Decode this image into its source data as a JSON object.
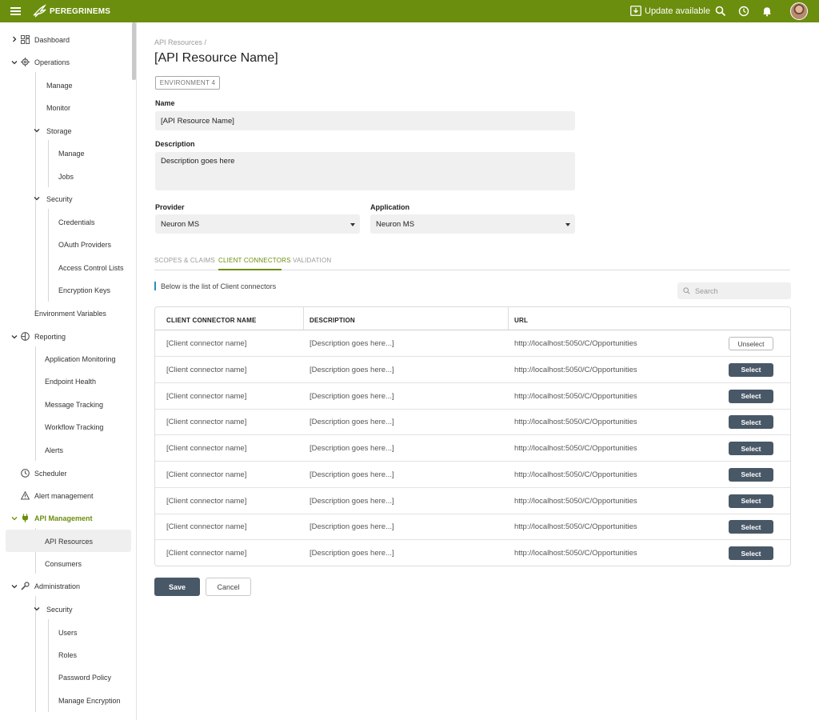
{
  "colors": {
    "brand": "#6b8e0e",
    "button_dark": "#495867",
    "info_accent": "#2d8fb7"
  },
  "topbar": {
    "logo_text": "PEREGRINEMS",
    "update_label": "Update available",
    "icons": [
      "menu-icon",
      "download-icon",
      "search-icon",
      "clock-icon",
      "bell-icon"
    ]
  },
  "sidebar": {
    "dashboard": "Dashboard",
    "operations": "Operations",
    "ops_manage": "Manage",
    "ops_monitor": "Monitor",
    "storage": "Storage",
    "storage_manage": "Manage",
    "storage_jobs": "Jobs",
    "security": "Security",
    "credentials": "Credentials",
    "oauth": "OAuth Providers",
    "acl": "Access Control Lists",
    "enc_keys": "Encryption Keys",
    "env_vars": "Environment Variables",
    "reporting": "Reporting",
    "app_monitoring": "Application Monitoring",
    "endpoint_health": "Endpoint Health",
    "message_tracking": "Message Tracking",
    "workflow_tracking": "Workflow Tracking",
    "alerts": "Alerts",
    "scheduler": "Scheduler",
    "alert_mgmt": "Alert management",
    "api_mgmt": "API Management",
    "api_resources": "API Resources",
    "consumers": "Consumers",
    "administration": "Administration",
    "admin_security": "Security",
    "users": "Users",
    "roles": "Roles",
    "password_policy": "Password Policy",
    "manage_encryption": "Manage Encryption"
  },
  "main": {
    "breadcrumb": "API Resources /",
    "title": "[API Resource Name]",
    "environment_tag": "ENVIRONMENT 4",
    "name_label": "Name",
    "name_value": "[API Resource Name]",
    "description_label": "Description",
    "description_value": "Description goes here",
    "provider_label": "Provider",
    "provider_value": "Neuron MS",
    "application_label": "Application",
    "application_value": "Neuron MS",
    "tabs": [
      "SCOPES & CLAIMS",
      "CLIENT CONNECTORS",
      "VALIDATION"
    ],
    "info_text": "Below is the list of Client connectors",
    "search_placeholder": "Search",
    "table": {
      "headers": [
        "CLIENT CONNECTOR NAME",
        "DESCRIPTION",
        "URL"
      ],
      "rows": [
        {
          "name": "[Client connector name]",
          "description": "[Description goes here...]",
          "url": "http://localhost:5050/C/Opportunities",
          "action": "Unselect"
        },
        {
          "name": "[Client connector name]",
          "description": "[Description goes here...]",
          "url": "http://localhost:5050/C/Opportunities",
          "action": "Select"
        },
        {
          "name": "[Client connector name]",
          "description": "[Description goes here...]",
          "url": "http://localhost:5050/C/Opportunities",
          "action": "Select"
        },
        {
          "name": "[Client connector name]",
          "description": "[Description goes here...]",
          "url": "http://localhost:5050/C/Opportunities",
          "action": "Select"
        },
        {
          "name": "[Client connector name]",
          "description": "[Description goes here...]",
          "url": "http://localhost:5050/C/Opportunities",
          "action": "Select"
        },
        {
          "name": "[Client connector name]",
          "description": "[Description goes here...]",
          "url": "http://localhost:5050/C/Opportunities",
          "action": "Select"
        },
        {
          "name": "[Client connector name]",
          "description": "[Description goes here...]",
          "url": "http://localhost:5050/C/Opportunities",
          "action": "Select"
        },
        {
          "name": "[Client connector name]",
          "description": "[Description goes here...]",
          "url": "http://localhost:5050/C/Opportunities",
          "action": "Select"
        },
        {
          "name": "[Client connector name]",
          "description": "[Description goes here...]",
          "url": "http://localhost:5050/C/Opportunities",
          "action": "Select"
        }
      ]
    },
    "save_label": "Save",
    "cancel_label": "Cancel"
  }
}
